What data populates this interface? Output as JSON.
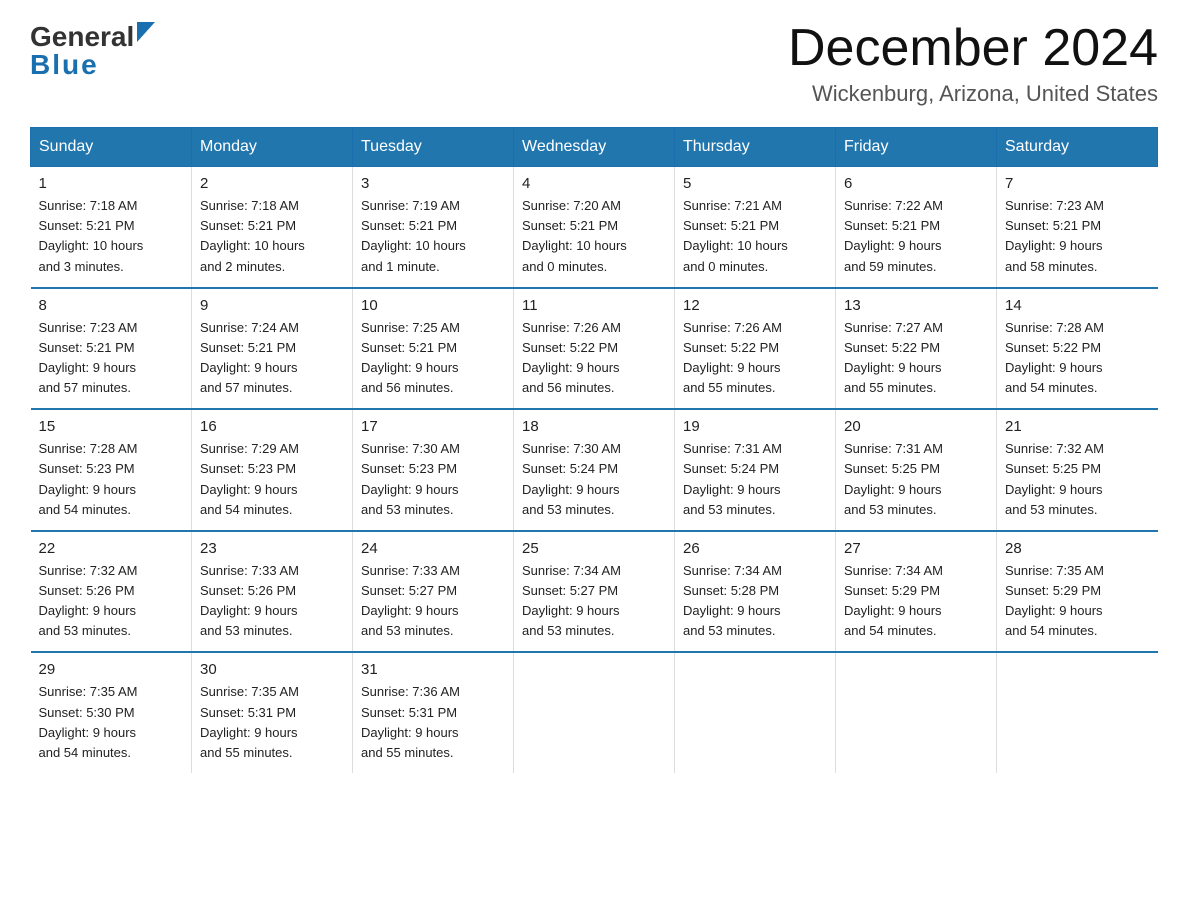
{
  "header": {
    "logo_general": "General",
    "logo_blue": "Blue",
    "month_title": "December 2024",
    "location": "Wickenburg, Arizona, United States"
  },
  "days_of_week": [
    "Sunday",
    "Monday",
    "Tuesday",
    "Wednesday",
    "Thursday",
    "Friday",
    "Saturday"
  ],
  "weeks": [
    [
      {
        "num": "1",
        "sunrise": "7:18 AM",
        "sunset": "5:21 PM",
        "daylight": "10 hours and 3 minutes."
      },
      {
        "num": "2",
        "sunrise": "7:18 AM",
        "sunset": "5:21 PM",
        "daylight": "10 hours and 2 minutes."
      },
      {
        "num": "3",
        "sunrise": "7:19 AM",
        "sunset": "5:21 PM",
        "daylight": "10 hours and 1 minute."
      },
      {
        "num": "4",
        "sunrise": "7:20 AM",
        "sunset": "5:21 PM",
        "daylight": "10 hours and 0 minutes."
      },
      {
        "num": "5",
        "sunrise": "7:21 AM",
        "sunset": "5:21 PM",
        "daylight": "10 hours and 0 minutes."
      },
      {
        "num": "6",
        "sunrise": "7:22 AM",
        "sunset": "5:21 PM",
        "daylight": "9 hours and 59 minutes."
      },
      {
        "num": "7",
        "sunrise": "7:23 AM",
        "sunset": "5:21 PM",
        "daylight": "9 hours and 58 minutes."
      }
    ],
    [
      {
        "num": "8",
        "sunrise": "7:23 AM",
        "sunset": "5:21 PM",
        "daylight": "9 hours and 57 minutes."
      },
      {
        "num": "9",
        "sunrise": "7:24 AM",
        "sunset": "5:21 PM",
        "daylight": "9 hours and 57 minutes."
      },
      {
        "num": "10",
        "sunrise": "7:25 AM",
        "sunset": "5:21 PM",
        "daylight": "9 hours and 56 minutes."
      },
      {
        "num": "11",
        "sunrise": "7:26 AM",
        "sunset": "5:22 PM",
        "daylight": "9 hours and 56 minutes."
      },
      {
        "num": "12",
        "sunrise": "7:26 AM",
        "sunset": "5:22 PM",
        "daylight": "9 hours and 55 minutes."
      },
      {
        "num": "13",
        "sunrise": "7:27 AM",
        "sunset": "5:22 PM",
        "daylight": "9 hours and 55 minutes."
      },
      {
        "num": "14",
        "sunrise": "7:28 AM",
        "sunset": "5:22 PM",
        "daylight": "9 hours and 54 minutes."
      }
    ],
    [
      {
        "num": "15",
        "sunrise": "7:28 AM",
        "sunset": "5:23 PM",
        "daylight": "9 hours and 54 minutes."
      },
      {
        "num": "16",
        "sunrise": "7:29 AM",
        "sunset": "5:23 PM",
        "daylight": "9 hours and 54 minutes."
      },
      {
        "num": "17",
        "sunrise": "7:30 AM",
        "sunset": "5:23 PM",
        "daylight": "9 hours and 53 minutes."
      },
      {
        "num": "18",
        "sunrise": "7:30 AM",
        "sunset": "5:24 PM",
        "daylight": "9 hours and 53 minutes."
      },
      {
        "num": "19",
        "sunrise": "7:31 AM",
        "sunset": "5:24 PM",
        "daylight": "9 hours and 53 minutes."
      },
      {
        "num": "20",
        "sunrise": "7:31 AM",
        "sunset": "5:25 PM",
        "daylight": "9 hours and 53 minutes."
      },
      {
        "num": "21",
        "sunrise": "7:32 AM",
        "sunset": "5:25 PM",
        "daylight": "9 hours and 53 minutes."
      }
    ],
    [
      {
        "num": "22",
        "sunrise": "7:32 AM",
        "sunset": "5:26 PM",
        "daylight": "9 hours and 53 minutes."
      },
      {
        "num": "23",
        "sunrise": "7:33 AM",
        "sunset": "5:26 PM",
        "daylight": "9 hours and 53 minutes."
      },
      {
        "num": "24",
        "sunrise": "7:33 AM",
        "sunset": "5:27 PM",
        "daylight": "9 hours and 53 minutes."
      },
      {
        "num": "25",
        "sunrise": "7:34 AM",
        "sunset": "5:27 PM",
        "daylight": "9 hours and 53 minutes."
      },
      {
        "num": "26",
        "sunrise": "7:34 AM",
        "sunset": "5:28 PM",
        "daylight": "9 hours and 53 minutes."
      },
      {
        "num": "27",
        "sunrise": "7:34 AM",
        "sunset": "5:29 PM",
        "daylight": "9 hours and 54 minutes."
      },
      {
        "num": "28",
        "sunrise": "7:35 AM",
        "sunset": "5:29 PM",
        "daylight": "9 hours and 54 minutes."
      }
    ],
    [
      {
        "num": "29",
        "sunrise": "7:35 AM",
        "sunset": "5:30 PM",
        "daylight": "9 hours and 54 minutes."
      },
      {
        "num": "30",
        "sunrise": "7:35 AM",
        "sunset": "5:31 PM",
        "daylight": "9 hours and 55 minutes."
      },
      {
        "num": "31",
        "sunrise": "7:36 AM",
        "sunset": "5:31 PM",
        "daylight": "9 hours and 55 minutes."
      },
      null,
      null,
      null,
      null
    ]
  ],
  "labels": {
    "sunrise": "Sunrise:",
    "sunset": "Sunset:",
    "daylight": "Daylight:"
  }
}
